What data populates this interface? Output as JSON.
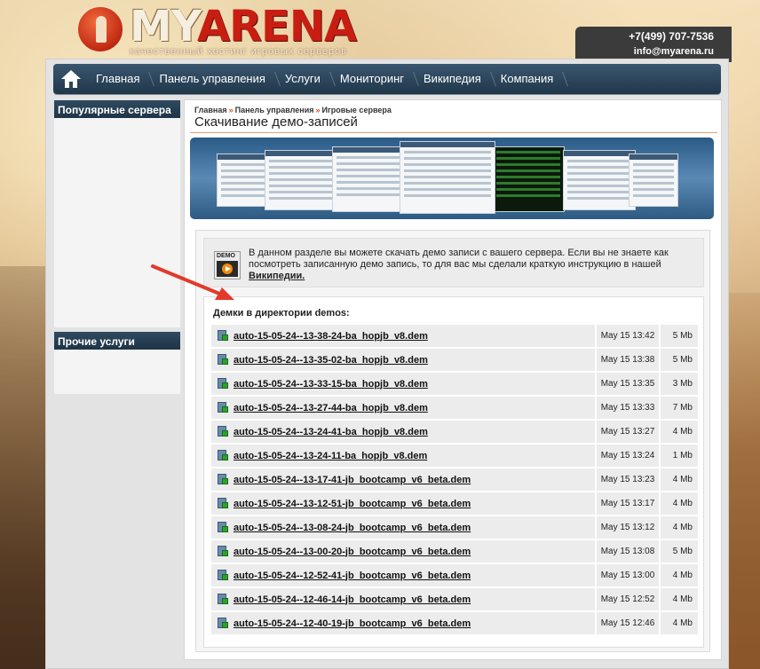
{
  "header": {
    "logo_my": "MY",
    "logo_arena": "ARENA",
    "tagline": "качественный хостинг игровых серверов",
    "phone": "+7(499) 707-7536",
    "email": "info@myarena.ru"
  },
  "nav": {
    "home_icon": "home-icon",
    "items": [
      {
        "label": "Главная"
      },
      {
        "label": "Панель управления"
      },
      {
        "label": "Услуги"
      },
      {
        "label": "Мониторинг"
      },
      {
        "label": "Википедия"
      },
      {
        "label": "Компания"
      }
    ]
  },
  "sidebar": {
    "popular_title": "Популярные сервера",
    "other_title": "Прочие услуги"
  },
  "breadcrumb": [
    "Главная",
    "Панель управления",
    "Игровые сервера"
  ],
  "page_title": "Скачивание демо-записей",
  "intro": {
    "icon_label": "DEMO",
    "text": "В данном разделе вы можете скачать демо записи с вашего сервера. Если вы не знаете как посмотреть записанную демо запись, то для вас мы сделали краткую инструкцию в нашей ",
    "link": "Википедии."
  },
  "demos": {
    "heading": "Демки в директории demos:",
    "files": [
      {
        "name": "auto-15-05-24--13-38-24-ba_hopjb_v8.dem",
        "date": "May 15 13:42",
        "size": "5 Mb"
      },
      {
        "name": "auto-15-05-24--13-35-02-ba_hopjb_v8.dem",
        "date": "May 15 13:38",
        "size": "5 Mb"
      },
      {
        "name": "auto-15-05-24--13-33-15-ba_hopjb_v8.dem",
        "date": "May 15 13:35",
        "size": "3 Mb"
      },
      {
        "name": "auto-15-05-24--13-27-44-ba_hopjb_v8.dem",
        "date": "May 15 13:33",
        "size": "7 Mb"
      },
      {
        "name": "auto-15-05-24--13-24-41-ba_hopjb_v8.dem",
        "date": "May 15 13:27",
        "size": "4 Mb"
      },
      {
        "name": "auto-15-05-24--13-24-11-ba_hopjb_v8.dem",
        "date": "May 15 13:24",
        "size": "1 Mb"
      },
      {
        "name": "auto-15-05-24--13-17-41-jb_bootcamp_v6_beta.dem",
        "date": "May 15 13:23",
        "size": "4 Mb"
      },
      {
        "name": "auto-15-05-24--13-12-51-jb_bootcamp_v6_beta.dem",
        "date": "May 15 13:17",
        "size": "4 Mb"
      },
      {
        "name": "auto-15-05-24--13-08-24-jb_bootcamp_v6_beta.dem",
        "date": "May 15 13:12",
        "size": "4 Mb"
      },
      {
        "name": "auto-15-05-24--13-00-20-jb_bootcamp_v6_beta.dem",
        "date": "May 15 13:08",
        "size": "5 Mb"
      },
      {
        "name": "auto-15-05-24--12-52-41-jb_bootcamp_v6_beta.dem",
        "date": "May 15 13:00",
        "size": "4 Mb"
      },
      {
        "name": "auto-15-05-24--12-46-14-jb_bootcamp_v6_beta.dem",
        "date": "May 15 12:52",
        "size": "4 Mb"
      },
      {
        "name": "auto-15-05-24--12-40-19-jb_bootcamp_v6_beta.dem",
        "date": "May 15 12:46",
        "size": "4 Mb"
      }
    ]
  },
  "colors": {
    "nav_bg": "#2c4558",
    "annotation_arrow": "#e23a2a",
    "logo_red": "#c81e12"
  }
}
